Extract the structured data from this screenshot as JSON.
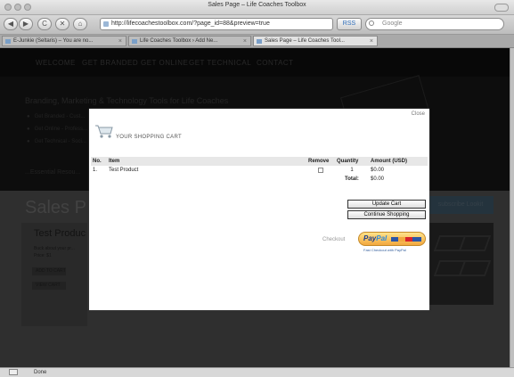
{
  "window": {
    "title": "Sales Page – Life Coaches Toolbox"
  },
  "toolbar": {
    "url": "http://lifecoachestoolbox.com/?page_id=88&preview=true",
    "go_label": "RSS",
    "search_placeholder": "Google",
    "nav": [
      "◀",
      "▶",
      "C",
      "✕",
      "⌂"
    ]
  },
  "tabs": [
    {
      "label": "E-Junkie (Seltaris) – You are no...",
      "active": false
    },
    {
      "label": "Life Coaches Toolbox › Add Ne...",
      "active": false
    },
    {
      "label": "Sales Page – Life Coaches Tool...",
      "active": true
    }
  ],
  "site": {
    "nav": [
      "WELCOME",
      "GET BRANDED",
      "GET ONLINE",
      "GET TECHNICAL",
      "CONTACT"
    ],
    "hero_title": "Branding, Marketing & Technology Tools for Life Coaches",
    "bullets": [
      "Get Branded - Cust...",
      "Get Online - Profess...",
      "Get Technical - Soci..."
    ],
    "essential": "...Essential Resou...",
    "sales_heading": "Sales P",
    "sidebar_label": "subscribe Lookit",
    "product_title": "Test Produc",
    "product_desc": "Buck about your pr...",
    "product_price": "Price: $1",
    "buttons": [
      "ADD TO CART",
      "VIEW CART"
    ]
  },
  "status": {
    "text": "Done"
  },
  "cart": {
    "close_label": "Close",
    "title": "YOUR SHOPPING CART",
    "headers": {
      "no": "No.",
      "item": "Item",
      "remove": "Remove",
      "quantity": "Quantity",
      "amount": "Amount (USD)"
    },
    "rows": [
      {
        "no": "1.",
        "item": "Test Product",
        "quantity": "1",
        "amount": "$0.00"
      }
    ],
    "total_label": "Total:",
    "total_value": "$0.00",
    "update_label": "Update Cart",
    "continue_label": "Continue Shopping",
    "checkout_label": "Checkout",
    "paypal_pay": "Pay",
    "paypal_pal": "Pal",
    "paypal_sub": "Fast Checkout with PayPal"
  }
}
